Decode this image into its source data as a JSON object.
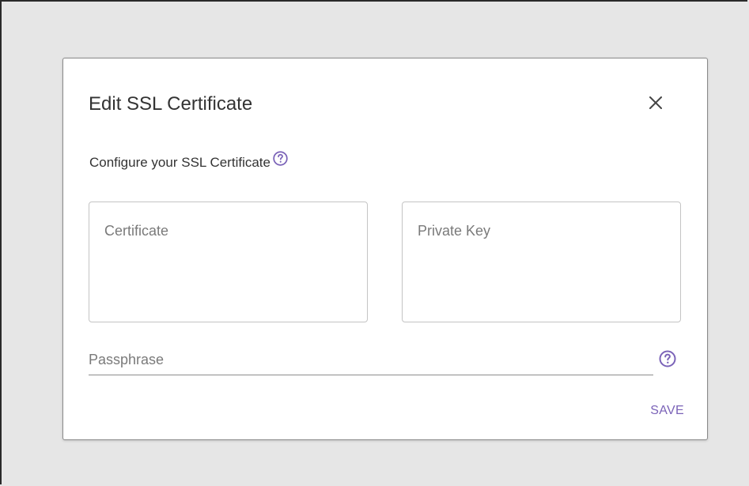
{
  "dialog": {
    "title": "Edit SSL Certificate",
    "subtitle": "Configure your SSL Certificate",
    "close_icon": "close-icon",
    "help_icon": "help-circle-icon"
  },
  "fields": {
    "certificate": {
      "value": "",
      "placeholder": "Certificate"
    },
    "private_key": {
      "value": "",
      "placeholder": "Private Key"
    },
    "passphrase": {
      "value": "",
      "placeholder": "Passphrase"
    }
  },
  "actions": {
    "save_label": "SAVE"
  },
  "colors": {
    "accent": "#7b63b8",
    "backdrop": "#e6e6e6",
    "text": "#333333",
    "placeholder": "#7a7a7a"
  }
}
